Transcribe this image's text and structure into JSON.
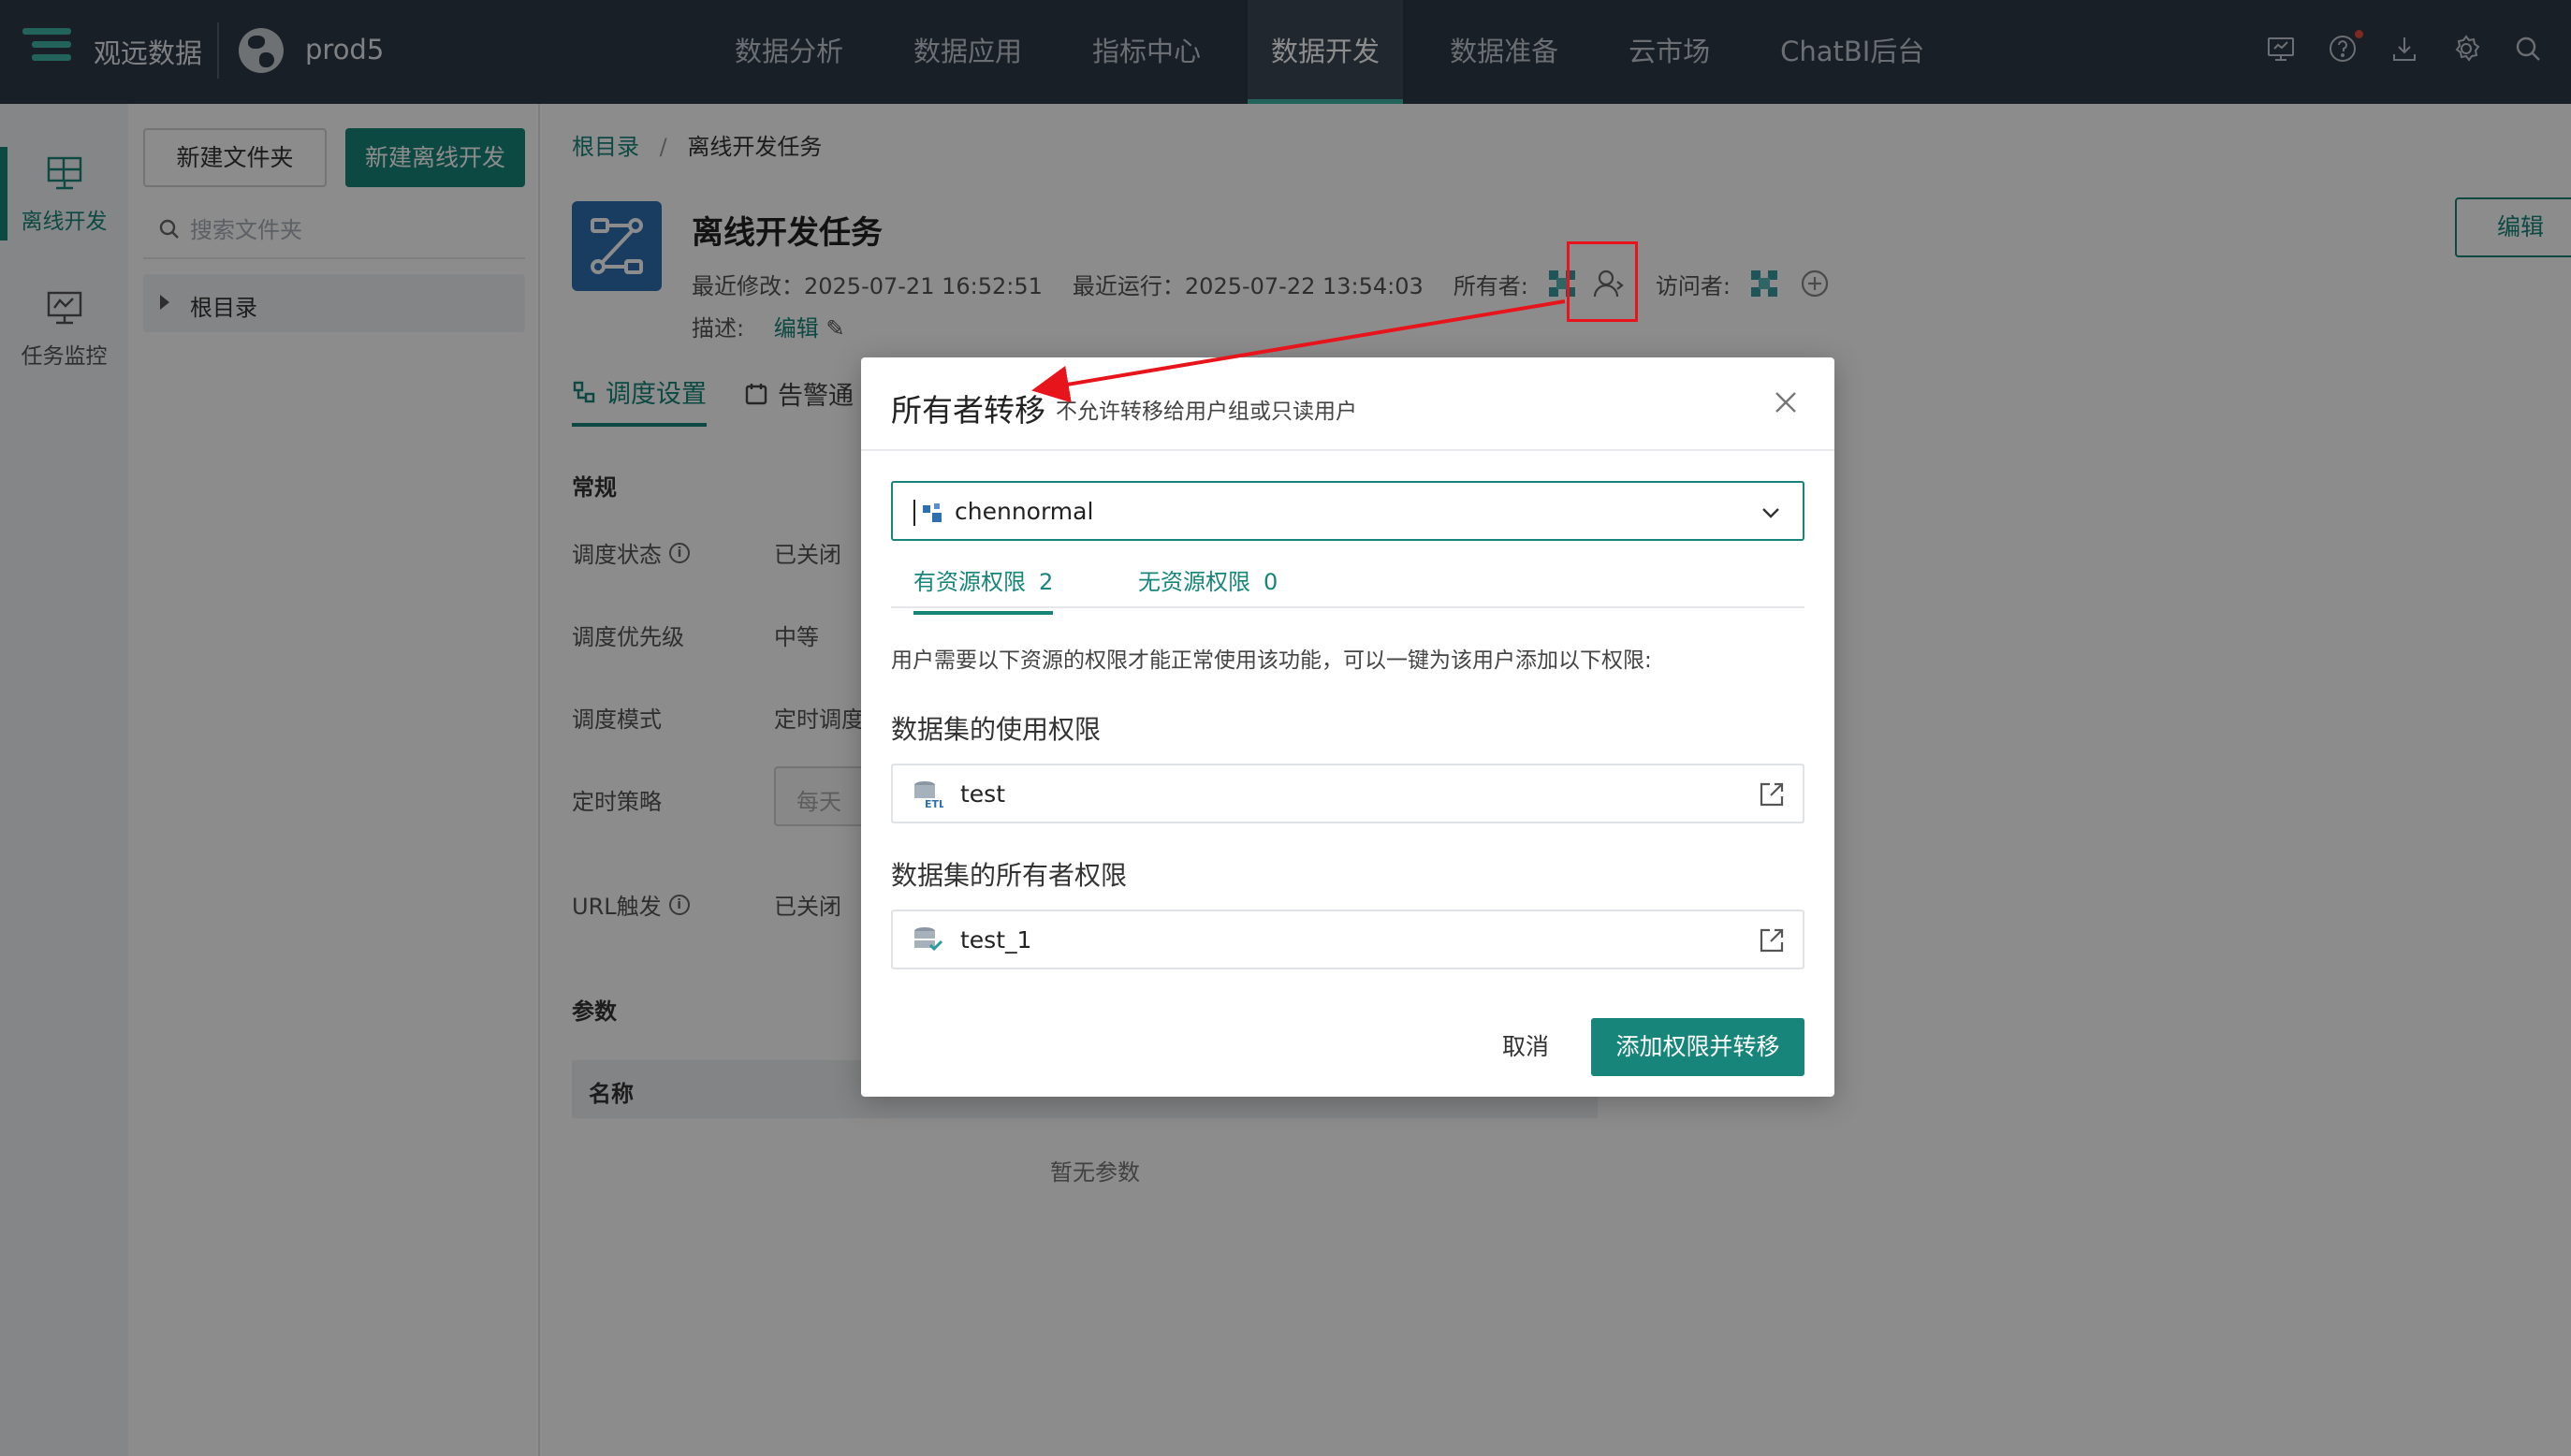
{
  "topnav": {
    "brand": "观远数据",
    "space": "prod5",
    "items": [
      "数据分析",
      "数据应用",
      "指标中心",
      "数据开发",
      "数据准备",
      "云市场",
      "ChatBI后台"
    ],
    "active_item": "数据开发",
    "icons": [
      "monitor-icon",
      "help-icon",
      "download-icon",
      "settings-icon",
      "search-icon"
    ]
  },
  "rail": {
    "items": [
      {
        "label": "离线开发",
        "icon": "offline-dev-icon",
        "active": true
      },
      {
        "label": "任务监控",
        "icon": "task-monitor-icon",
        "active": false
      }
    ]
  },
  "folder_panel": {
    "new_folder": "新建文件夹",
    "new_offline": "新建离线开发",
    "search_placeholder": "搜索文件夹",
    "root": "根目录"
  },
  "main": {
    "breadcrumb": {
      "root": "根目录",
      "sep": "/",
      "current": "离线开发任务"
    },
    "title": "离线开发任务",
    "last_modified": "最近修改：2025-07-21 16:52:51",
    "last_run": "最近运行：2025-07-22 13:54:03",
    "owner_label": "所有者:",
    "visitor_label": "访问者:",
    "desc_label": "描述:",
    "desc_edit": "编辑",
    "edit_button": "编辑",
    "tabs": [
      "调度设置",
      "告警通"
    ],
    "section_general": "常规",
    "fields": [
      {
        "label": "调度状态",
        "value": "已关闭",
        "info": true
      },
      {
        "label": "调度优先级",
        "value": "中等",
        "info": false
      },
      {
        "label": "调度模式",
        "value": "定时调度",
        "info": false
      },
      {
        "label": "定时策略",
        "value": "每天",
        "info": false
      },
      {
        "label": "URL触发",
        "value": "已关闭",
        "info": true
      }
    ],
    "section_params": "参数",
    "param_header": [
      "名称"
    ],
    "empty_params": "暂无参数"
  },
  "modal": {
    "title": "所有者转移",
    "subtitle": "不允许转移给用户组或只读用户",
    "selected_user": "chennormal",
    "tabs": [
      {
        "label": "有资源权限",
        "count": "2"
      },
      {
        "label": "无资源权限",
        "count": "0"
      }
    ],
    "hint": "用户需要以下资源的权限才能正常使用该功能，可以一键为该用户添加以下权限:",
    "sections": [
      {
        "title": "数据集的使用权限",
        "item": "test"
      },
      {
        "title": "数据集的所有者权限",
        "item": "test_1"
      }
    ],
    "cancel": "取消",
    "confirm": "添加权限并转移"
  },
  "colors": {
    "accent": "#17857a",
    "nav_bg": "#2f3a46",
    "annotation": "#e8141b"
  }
}
